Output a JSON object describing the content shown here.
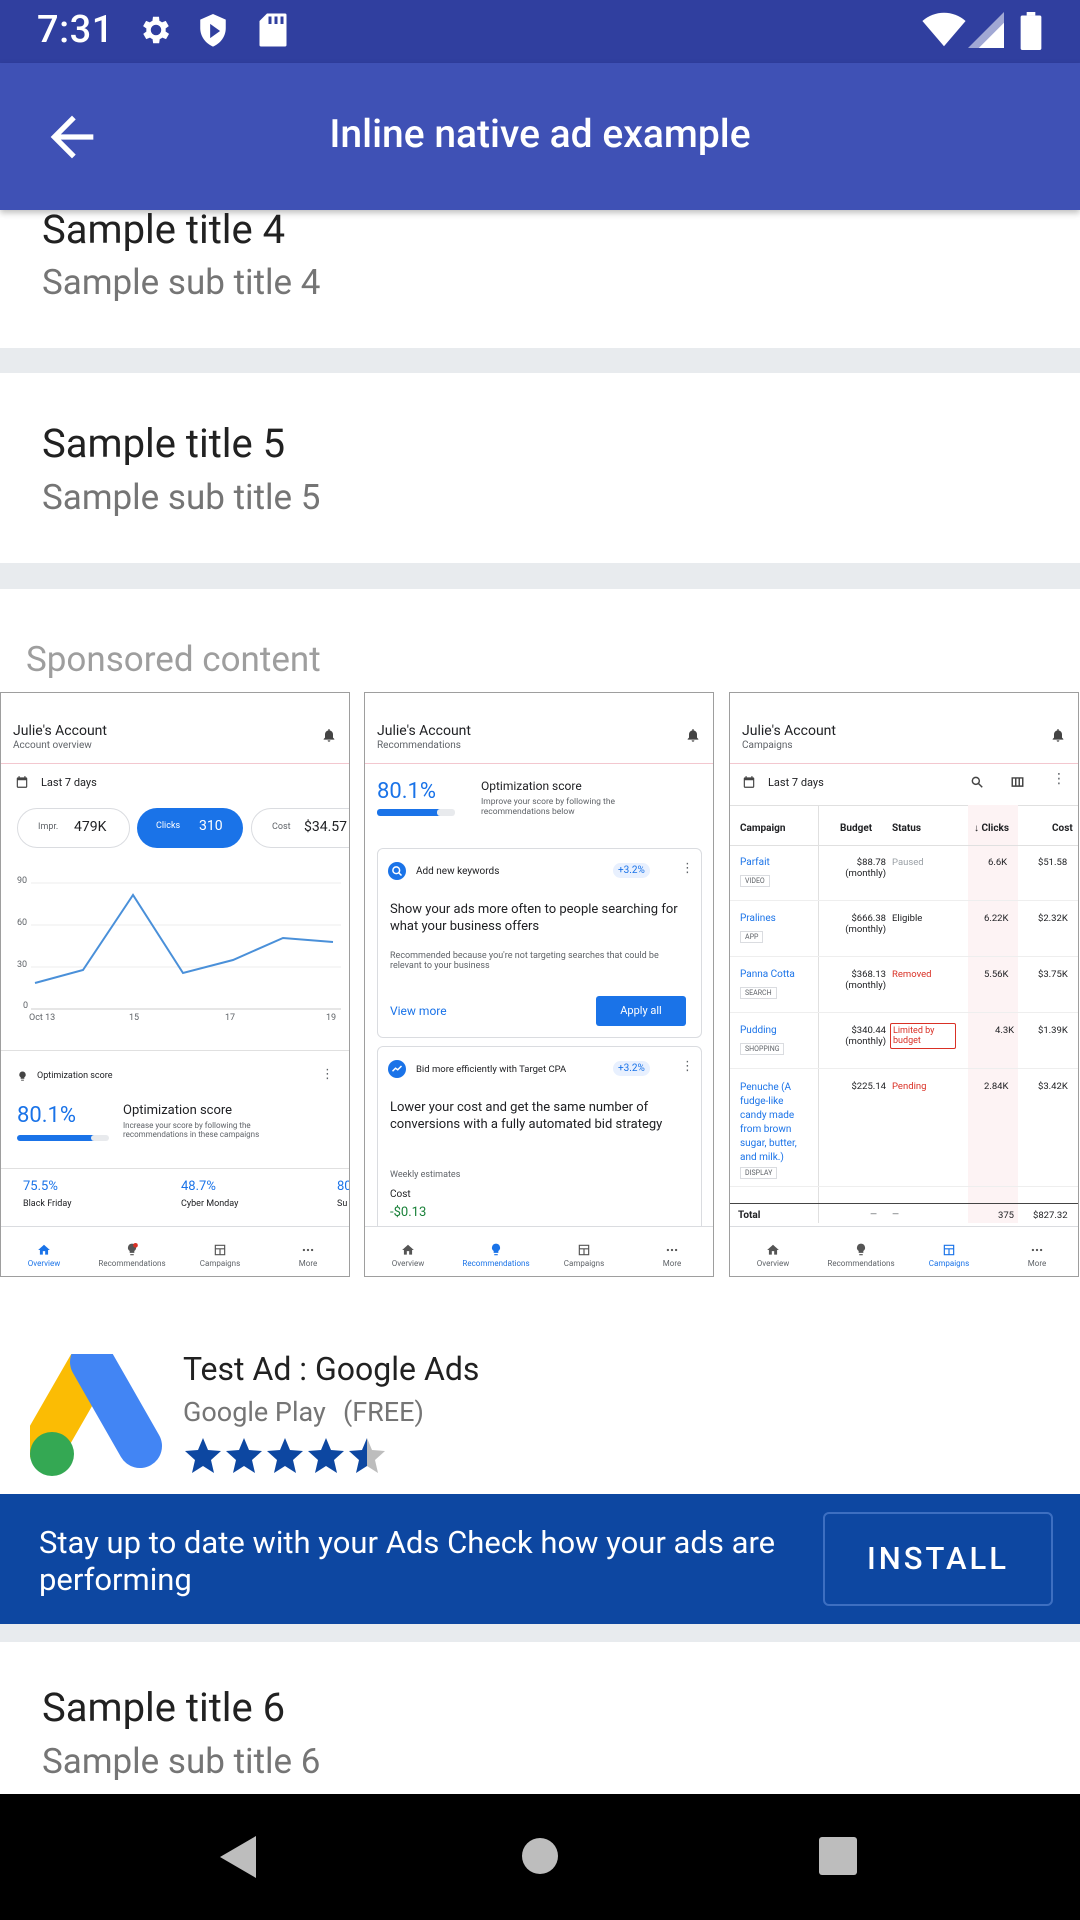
{
  "status_bar": {
    "time": "7:31",
    "icons": [
      "gear-icon",
      "shield-icon",
      "sd-card-icon",
      "wifi-icon",
      "signal-icon",
      "battery-icon"
    ]
  },
  "app_bar": {
    "title": "Inline native ad example",
    "back_icon": "arrow-back-icon"
  },
  "list": {
    "item4": {
      "title": "Sample title 4",
      "subtitle": "Sample sub title 4"
    },
    "item5": {
      "title": "Sample title 5",
      "subtitle": "Sample sub title 5"
    },
    "item6": {
      "title": "Sample title 6",
      "subtitle": "Sample sub title 6"
    }
  },
  "ad": {
    "sponsored_label": "Sponsored content",
    "headline": "Test Ad : Google Ads",
    "store": "Google Play",
    "price": "(FREE)",
    "rating": 4.5,
    "body": "Stay up to date with your Ads Check how your ads are performing",
    "cta": "INSTALL",
    "brand_colors": {
      "yellow": "#fbbc04",
      "blue": "#4285f4",
      "green": "#34a853",
      "cta_bg": "#0d47a1"
    }
  },
  "screens": {
    "overview": {
      "account": "Julie's Account",
      "subtitle": "Account overview",
      "date_range": "Last 7 days",
      "chips": [
        {
          "label": "Impr.",
          "value": "479K"
        },
        {
          "label": "Clicks",
          "value": "310"
        },
        {
          "label": "Cost",
          "value": "$34.57"
        }
      ],
      "chart_y_ticks": [
        "90",
        "60",
        "30",
        "0"
      ],
      "chart_x_ticks": [
        "Oct 13",
        "15",
        "17",
        "19"
      ],
      "opt_label": "Optimization score",
      "opt_value": "80.1%",
      "opt_title": "Optimization score",
      "opt_desc": "Increase your score by following the recommendations in these campaigns",
      "campaigns": [
        {
          "value": "75.5%",
          "name": "Black Friday"
        },
        {
          "value": "48.7%",
          "name": "Cyber Monday"
        },
        {
          "value": "80",
          "name": "Su"
        }
      ]
    },
    "recommendations": {
      "account": "Julie's Account",
      "subtitle": "Recommendations",
      "score": "80.1%",
      "opt_title": "Optimization score",
      "opt_desc": "Improve your score by following the recommendations below",
      "card1": {
        "label": "Add new keywords",
        "badge": "+3.2%",
        "title": "Show your ads more often to people searching for what your business offers",
        "desc": "Recommended because you're not targeting searches that could be relevant to your business",
        "view_more": "View more",
        "apply": "Apply all"
      },
      "card2": {
        "label": "Bid more efficiently with Target CPA",
        "badge": "+3.2%",
        "title": "Lower your cost and get the same number of conversions with a fully automated bid strategy",
        "weekly": "Weekly estimates",
        "cost_label": "Cost",
        "cost_value": "-$0.13"
      }
    },
    "campaigns": {
      "account": "Julie's Account",
      "subtitle": "Campaigns",
      "date_range": "Last 7 days",
      "headers": [
        "Campaign",
        "Budget",
        "Status",
        "↓ Clicks",
        "Cost"
      ],
      "rows": [
        {
          "name": "Parfait",
          "tag": "VIDEO",
          "budget": "$88.78 (monthly)",
          "status": "Paused",
          "clicks": "6.6K",
          "cost": "$51.58"
        },
        {
          "name": "Pralines",
          "tag": "APP",
          "budget": "$666.38 (monthly)",
          "status": "Eligible",
          "clicks": "6.22K",
          "cost": "$2.32K"
        },
        {
          "name": "Panna Cotta",
          "tag": "SEARCH",
          "budget": "$368.13 (monthly)",
          "status": "Removed",
          "clicks": "5.56K",
          "cost": "$3.75K"
        },
        {
          "name": "Pudding",
          "tag": "SHOPPING",
          "budget": "$340.44 (monthly)",
          "status": "Limited by budget",
          "clicks": "4.3K",
          "cost": "$1.39K"
        },
        {
          "name": "Penuche (A fudge-like candy made from brown sugar, butter, and milk.)",
          "tag": "DISPLAY",
          "budget": "$225.14",
          "status": "Pending",
          "clicks": "2.84K",
          "cost": "$3.42K"
        }
      ],
      "total": {
        "label": "Total",
        "dash1": "—",
        "dash2": "—",
        "clicks": "375",
        "cost": "$827.32"
      }
    },
    "nav_items": [
      "Overview",
      "Recommendations",
      "Campaigns",
      "More"
    ]
  }
}
